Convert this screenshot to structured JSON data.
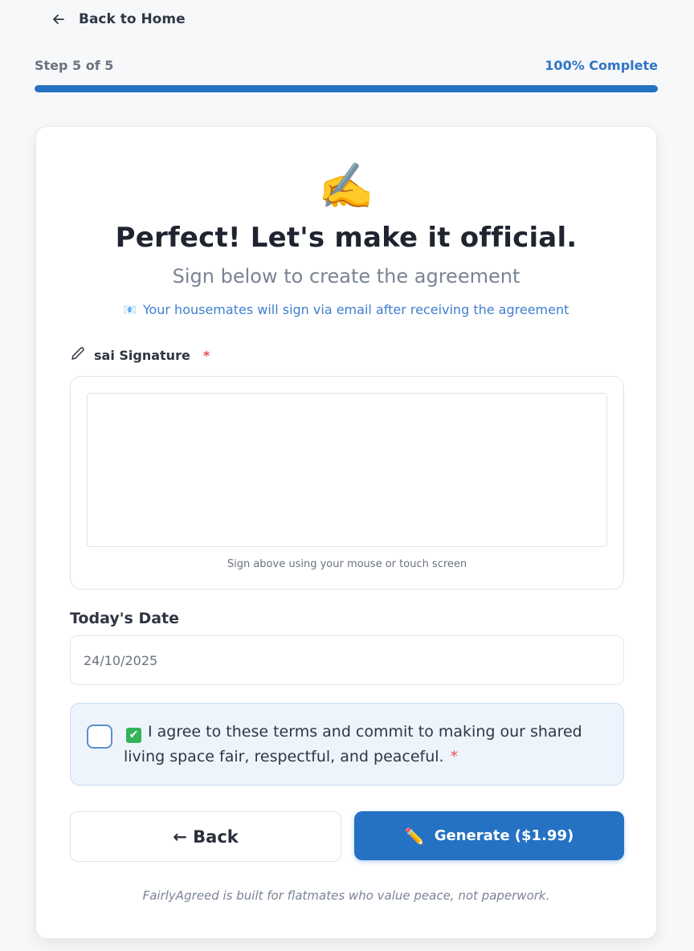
{
  "nav": {
    "back_home_label": "Back to Home",
    "back_icon": "arrow-left-icon"
  },
  "progress": {
    "step_label": "Step 5 of 5",
    "complete_label": "100% Complete",
    "percent": 100,
    "fill_color": "#2573c2"
  },
  "header": {
    "emoji": "✍️",
    "title": "Perfect! Let's make it official.",
    "subtitle": "Sign below to create the agreement",
    "info_icon": "📧",
    "info_text": "Your housemates will sign via email after receiving the agreement"
  },
  "signature": {
    "label": "sai Signature",
    "required_mark": "*",
    "icon": "pencil-icon",
    "hint": "Sign above using your mouse or touch screen"
  },
  "date": {
    "label": "Today's Date",
    "value": "24/10/2025"
  },
  "agreement": {
    "check_emoji": "✔",
    "text_main": "I agree to these terms and commit to making our shared living space fair, respectful, and peaceful.",
    "required_mark": "*",
    "checked": false
  },
  "buttons": {
    "back_label": "← Back",
    "generate_icon": "✏️",
    "generate_label": "Generate ($1.99)",
    "primary_color": "#2571c4"
  },
  "footer": {
    "note": "FairlyAgreed is built for flatmates who value peace, not paperwork."
  }
}
